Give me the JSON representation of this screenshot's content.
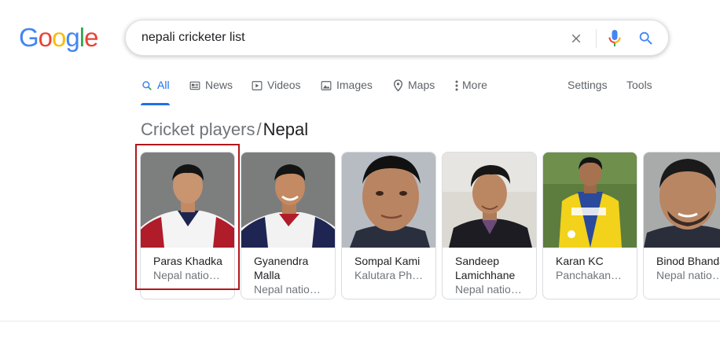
{
  "logo": {
    "letters": [
      "G",
      "o",
      "o",
      "g",
      "l",
      "e"
    ],
    "colors": [
      "#4285F4",
      "#EA4335",
      "#FBBC05",
      "#4285F4",
      "#34A853",
      "#EA4335"
    ]
  },
  "search": {
    "query": "nepali cricketer list"
  },
  "tabs": [
    {
      "label": "All",
      "icon": "search-icon",
      "active": true
    },
    {
      "label": "News",
      "icon": "news-icon"
    },
    {
      "label": "Videos",
      "icon": "video-icon"
    },
    {
      "label": "Images",
      "icon": "image-icon"
    },
    {
      "label": "Maps",
      "icon": "map-pin-icon"
    },
    {
      "label": "More",
      "icon": "more-vert-icon"
    }
  ],
  "settings_label": "Settings",
  "tools_label": "Tools",
  "heading": {
    "crumb": "Cricket players",
    "separator": "/",
    "current": "Nepal"
  },
  "players": [
    {
      "name": "Paras Khadka",
      "sub": "Nepal natio…"
    },
    {
      "name": "Gyanendra Malla",
      "sub": "Nepal natio…"
    },
    {
      "name": "Sompal Kami",
      "sub": "Kalutara Ph…"
    },
    {
      "name": "Sandeep Lamichhane",
      "sub": "Nepal natio…"
    },
    {
      "name": "Karan KC",
      "sub": "Panchakan…"
    },
    {
      "name": "Binod Bhandari",
      "sub": "Nepal natio…"
    }
  ],
  "colors": {
    "accent": "#1a73e8",
    "selection": "#b3161b"
  }
}
